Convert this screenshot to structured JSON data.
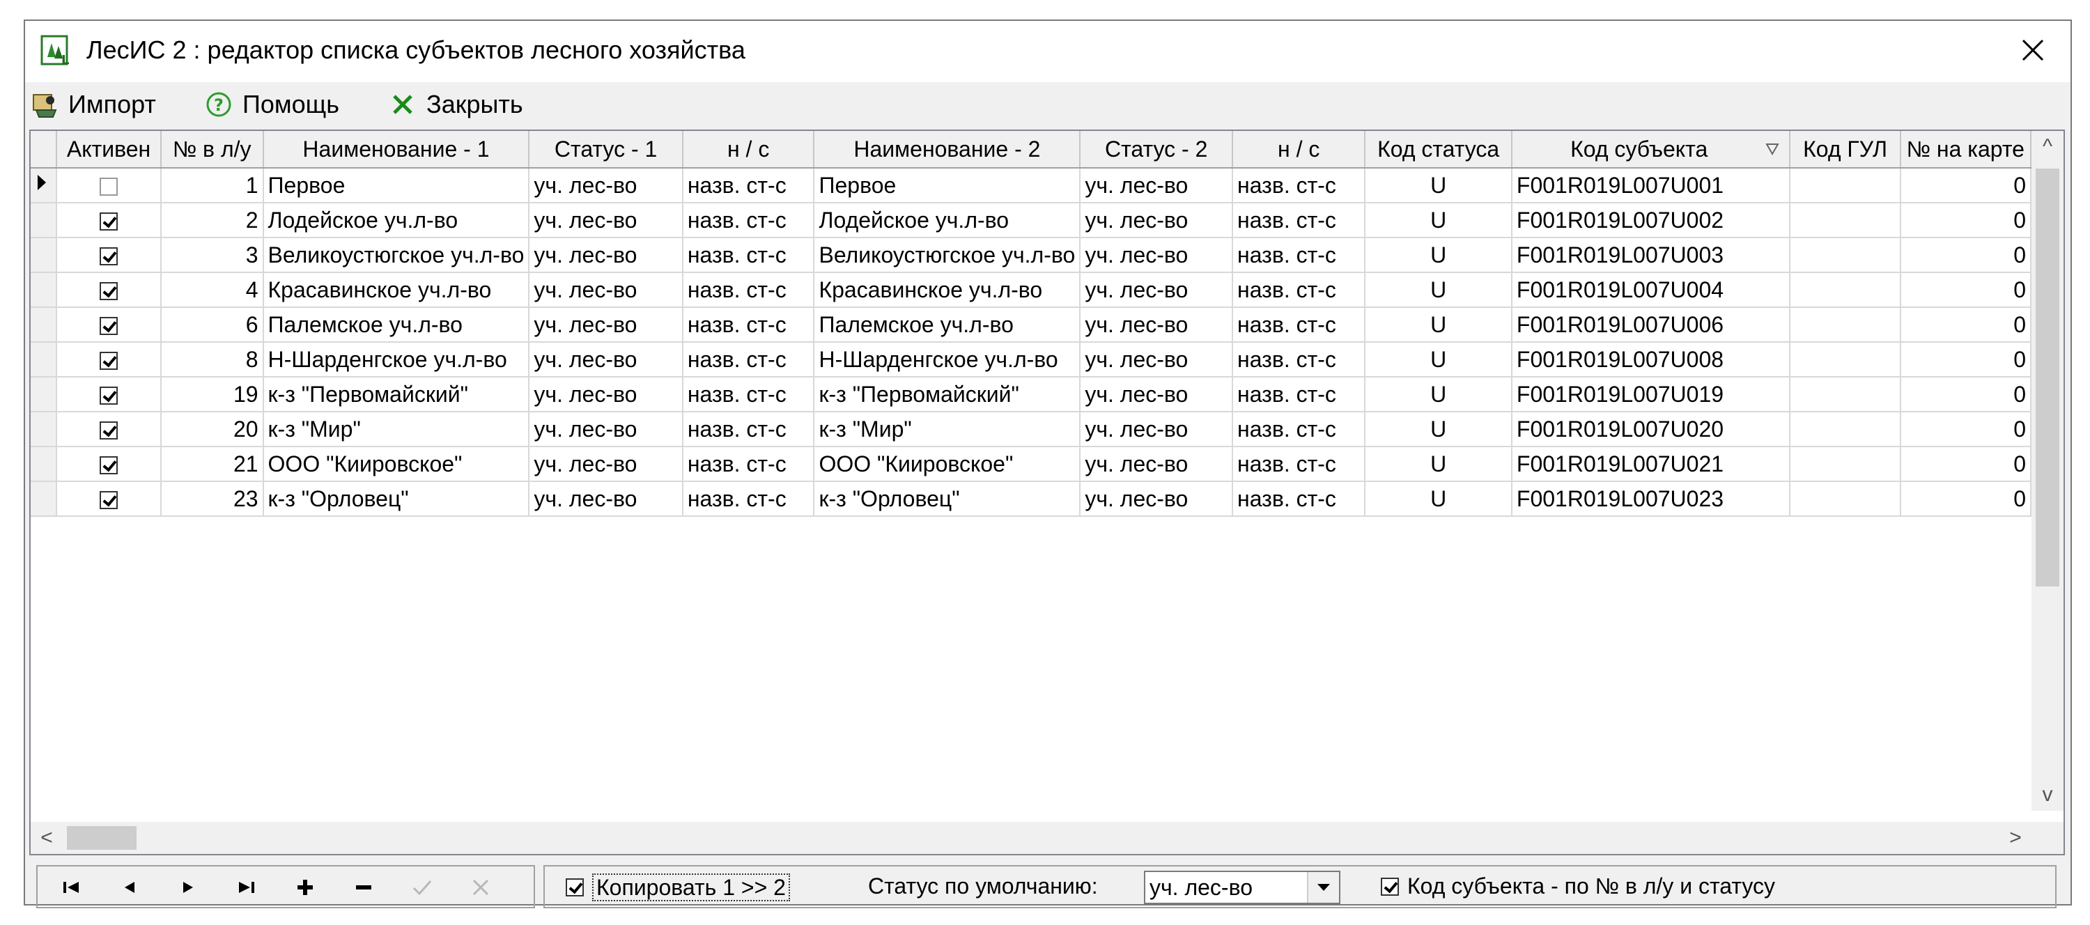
{
  "window": {
    "title": "ЛесИС 2 : редактор списка субъектов лесного хозяйства"
  },
  "toolbar": {
    "import_label": "Импорт",
    "help_label": "Помощь",
    "close_label": "Закрыть"
  },
  "grid": {
    "columns": [
      "Активен",
      "№ в л/у",
      "Наименование - 1",
      "Статус - 1",
      "н / с",
      "Наименование - 2",
      "Статус - 2",
      "н / с",
      "Код статуса",
      "Код субъекта",
      "Код ГУЛ",
      "№ на карте"
    ],
    "rows": [
      {
        "active": false,
        "num": "1",
        "name1": "Первое",
        "status1": "уч. лес-во",
        "ns1": "назв. ст-с",
        "name2": "Первое",
        "status2": "уч. лес-во",
        "ns2": "назв. ст-с",
        "status_code": "U",
        "subject_code": "F001R019L007U001",
        "gul": "",
        "map_no": "0"
      },
      {
        "active": true,
        "num": "2",
        "name1": "Лодейское уч.л-во",
        "status1": "уч. лес-во",
        "ns1": "назв. ст-с",
        "name2": "Лодейское уч.л-во",
        "status2": "уч. лес-во",
        "ns2": "назв. ст-с",
        "status_code": "U",
        "subject_code": "F001R019L007U002",
        "gul": "",
        "map_no": "0"
      },
      {
        "active": true,
        "num": "3",
        "name1": "Великоустюгское уч.л-во",
        "status1": "уч. лес-во",
        "ns1": "назв. ст-с",
        "name2": "Великоустюгское уч.л-во",
        "status2": "уч. лес-во",
        "ns2": "назв. ст-с",
        "status_code": "U",
        "subject_code": "F001R019L007U003",
        "gul": "",
        "map_no": "0"
      },
      {
        "active": true,
        "num": "4",
        "name1": "Красавинское уч.л-во",
        "status1": "уч. лес-во",
        "ns1": "назв. ст-с",
        "name2": "Красавинское уч.л-во",
        "status2": "уч. лес-во",
        "ns2": "назв. ст-с",
        "status_code": "U",
        "subject_code": "F001R019L007U004",
        "gul": "",
        "map_no": "0"
      },
      {
        "active": true,
        "num": "6",
        "name1": "Палемское уч.л-во",
        "status1": "уч. лес-во",
        "ns1": "назв. ст-с",
        "name2": "Палемское уч.л-во",
        "status2": "уч. лес-во",
        "ns2": "назв. ст-с",
        "status_code": "U",
        "subject_code": "F001R019L007U006",
        "gul": "",
        "map_no": "0"
      },
      {
        "active": true,
        "num": "8",
        "name1": "Н-Шарденгское уч.л-во",
        "status1": "уч. лес-во",
        "ns1": "назв. ст-с",
        "name2": "Н-Шарденгское уч.л-во",
        "status2": "уч. лес-во",
        "ns2": "назв. ст-с",
        "status_code": "U",
        "subject_code": "F001R019L007U008",
        "gul": "",
        "map_no": "0"
      },
      {
        "active": true,
        "num": "19",
        "name1": "к-з \"Первомайский\"",
        "status1": "уч. лес-во",
        "ns1": "назв. ст-с",
        "name2": "к-з \"Первомайский\"",
        "status2": "уч. лес-во",
        "ns2": "назв. ст-с",
        "status_code": "U",
        "subject_code": "F001R019L007U019",
        "gul": "",
        "map_no": "0"
      },
      {
        "active": true,
        "num": "20",
        "name1": "к-з \"Мир\"",
        "status1": "уч. лес-во",
        "ns1": "назв. ст-с",
        "name2": "к-з \"Мир\"",
        "status2": "уч. лес-во",
        "ns2": "назв. ст-с",
        "status_code": "U",
        "subject_code": "F001R019L007U020",
        "gul": "",
        "map_no": "0"
      },
      {
        "active": true,
        "num": "21",
        "name1": "ООО \"Киировское\"",
        "status1": "уч. лес-во",
        "ns1": "назв. ст-с",
        "name2": "ООО \"Киировское\"",
        "status2": "уч. лес-во",
        "ns2": "назв. ст-с",
        "status_code": "U",
        "subject_code": "F001R019L007U021",
        "gul": "",
        "map_no": "0"
      },
      {
        "active": true,
        "num": "23",
        "name1": "к-з \"Орловец\"",
        "status1": "уч. лес-во",
        "ns1": "назв. ст-с",
        "name2": "к-з \"Орловец\"",
        "status2": "уч. лес-во",
        "ns2": "назв. ст-с",
        "status_code": "U",
        "subject_code": "F001R019L007U023",
        "gul": "",
        "map_no": "0"
      }
    ]
  },
  "bottom": {
    "copy_label": "Копировать 1 >> 2",
    "copy_checked": true,
    "default_status_label": "Статус по умолчанию:",
    "default_status_value": "уч. лес-во",
    "subject_code_label": "Код субъекта - по № в л/у и статусу",
    "subject_code_checked": true
  },
  "icons": {
    "app": "app-icon",
    "import": "import-icon",
    "help": "help-icon",
    "close_tool": "close-x-icon",
    "nav": [
      "first-record-icon",
      "prior-record-icon",
      "next-record-icon",
      "last-record-icon",
      "insert-record-icon",
      "delete-record-icon",
      "post-edit-icon",
      "cancel-edit-icon"
    ]
  },
  "colors": {
    "close_x_green": "#1a8a1a",
    "help_green": "#2e9b2e",
    "grid_line": "#d8d8d8",
    "header_bg": "#f0f0f0"
  }
}
